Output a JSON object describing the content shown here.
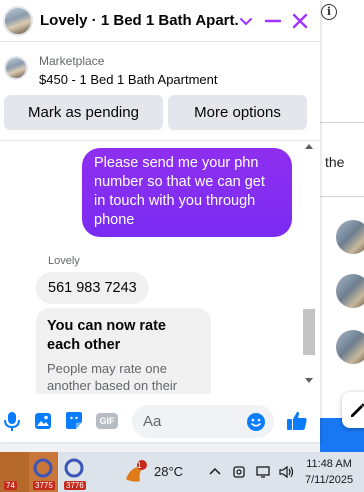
{
  "chat": {
    "title": "Lovely · 1 Bed 1 Bath Apart...",
    "listing": {
      "marketplace_label": "Marketplace",
      "title": "$450 - 1 Bed 1 Bath Apartment"
    },
    "buttons": {
      "mark_pending": "Mark as pending",
      "more_options": "More options"
    },
    "messages": {
      "outgoing": "Please send me your phn number so that we can get in touch with you through phone",
      "sender_name": "Lovely",
      "incoming": "561 983 7243",
      "rate_title": "You can now rate each other",
      "rate_body": "People may rate one another based on their"
    },
    "composer": {
      "placeholder": "Aa",
      "gif_label": "GIF"
    }
  },
  "background": {
    "side_text": "the",
    "info_glyph": "i"
  },
  "taskbar": {
    "apps": [
      {
        "badge": "74"
      },
      {
        "badge": "3775"
      },
      {
        "badge": "3776"
      }
    ],
    "weather_badge": "1",
    "temperature": "28°C",
    "time": "11:48 AM",
    "date": "7/11/2025"
  },
  "colors": {
    "accent": "#a033ff",
    "bubble_out": "#8a2ef0",
    "like_blue": "#0a7cff",
    "taskbar": "#dde3eb"
  }
}
